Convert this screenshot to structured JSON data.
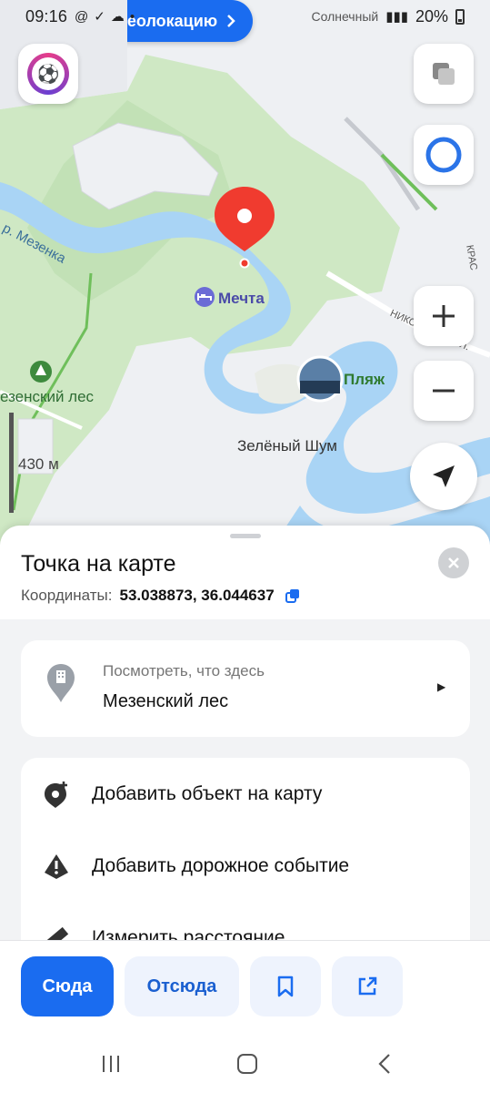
{
  "status_bar": {
    "time": "09:16",
    "left_icons": [
      "at-icon",
      "check-circle-icon",
      "cloud-icon",
      "dot-icon"
    ],
    "network_text": "Солнечный",
    "battery": "20%"
  },
  "map": {
    "geolocate_button": "Уточнить геолокацию",
    "labels": {
      "river": "р. Мезенка",
      "mechta": "Мечта",
      "beach": "Пляж",
      "zeleny_shum": "Зелёный Шум",
      "forest": "езенский лес",
      "scale": "430 м",
      "street1": "НИКОЛЬСКАЯ УЛ.",
      "street2": "КРАС"
    },
    "pin_color": "#f03b2f",
    "water_color": "#a9d4f5",
    "forest_color": "#cfe8c4"
  },
  "sheet": {
    "title": "Точка на карте",
    "coords_label": "Координаты:",
    "coords_value": "53.038873, 36.044637",
    "whats_here": {
      "subtitle": "Посмотреть, что здесь",
      "place": "Мезенский лес"
    },
    "actions": [
      {
        "icon": "add-place-icon",
        "label": "Добавить объект на карту"
      },
      {
        "icon": "warning-icon",
        "label": "Добавить дорожное событие"
      },
      {
        "icon": "ruler-icon",
        "label": "Измерить расстояние"
      }
    ]
  },
  "action_bar": {
    "to_label": "Сюда",
    "from_label": "Отсюда",
    "accent": "#1a6cf0"
  }
}
